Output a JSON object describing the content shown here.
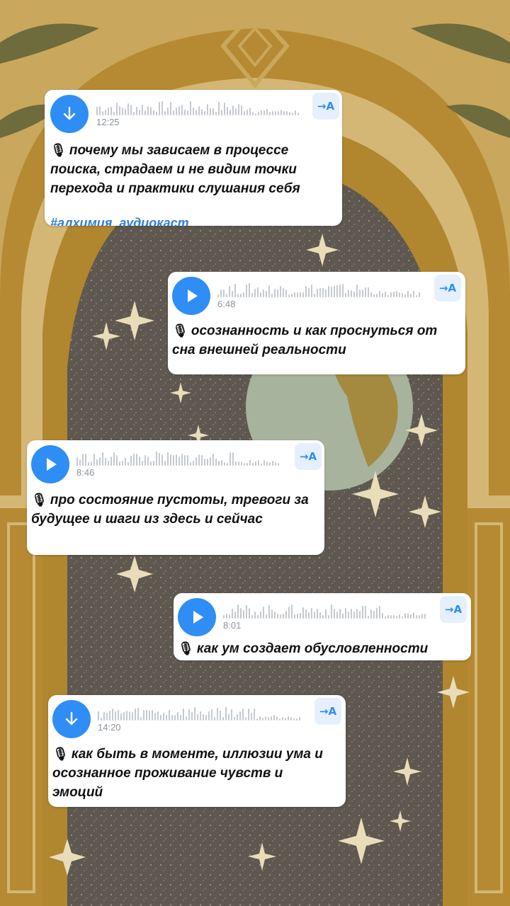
{
  "messages": [
    {
      "icon": "download-icon",
      "duration": "12:25",
      "translate_label": "→A",
      "mic_icon": "microphone-icon",
      "text": "почему мы зависаем в процессе поиска, страдаем и не видим точки перехода и практики слушания себя",
      "hashtag": "#алхимия_аудиокаст"
    },
    {
      "icon": "play-icon",
      "duration": "6:48",
      "translate_label": "→A",
      "mic_icon": "microphone-icon",
      "text": "осознанность и как проснуться от сна внешней реальности"
    },
    {
      "icon": "play-icon",
      "duration": "8:46",
      "translate_label": "→A",
      "mic_icon": "microphone-icon",
      "text": "про состояние пустоты, тревоги за будущее и шаги из здесь и сейчас"
    },
    {
      "icon": "play-icon",
      "duration": "8:01",
      "translate_label": "→A",
      "mic_icon": "microphone-icon",
      "text": "как ум создает обусловленности"
    },
    {
      "icon": "download-icon",
      "duration": "14:20",
      "translate_label": "→A",
      "mic_icon": "microphone-icon",
      "text": "как быть в моменте, иллюзии ума и осознанное проживание чувств и эмоций"
    }
  ],
  "colors": {
    "accent": "#2f8ef5",
    "card": "#ffffff",
    "background_gold": "#c9a75c",
    "arch_dark": "#5e5850"
  }
}
